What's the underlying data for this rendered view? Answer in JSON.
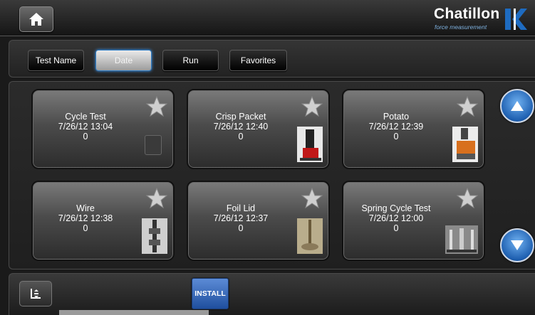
{
  "header": {
    "home_icon": "home-icon",
    "logo_name": "Chatillon",
    "logo_subtitle": "force measurement",
    "logo_trademark": "™"
  },
  "filters": [
    {
      "label": "Test Name",
      "active": false
    },
    {
      "label": "Date",
      "active": true
    },
    {
      "label": "Run",
      "active": false
    },
    {
      "label": "Favorites",
      "active": false
    }
  ],
  "tests": [
    {
      "name": "Cycle Test",
      "datetime": "7/26/12 13:04",
      "count": "0",
      "thumbnail": "empty"
    },
    {
      "name": "Crisp Packet",
      "datetime": "7/26/12 12:40",
      "count": "0",
      "thumbnail": "test-stand-red"
    },
    {
      "name": "Potato",
      "datetime": "7/26/12 12:39",
      "count": "0",
      "thumbnail": "fixture-orange"
    },
    {
      "name": "Wire",
      "datetime": "7/26/12 12:38",
      "count": "0",
      "thumbnail": "wire-grip"
    },
    {
      "name": "Foil Lid",
      "datetime": "7/26/12 12:37",
      "count": "0",
      "thumbnail": "foil-probe"
    },
    {
      "name": "Spring Cycle Test",
      "datetime": "7/26/12 12:00",
      "count": "0",
      "thumbnail": "spring-fixture"
    }
  ],
  "colors": {
    "accent_blue": "#2d7cc4",
    "install_blue": "#2a5cb0",
    "background": "#1a1a1a"
  },
  "footer": {
    "install_label": "INSTALL",
    "menu_icon": "sort-menu-icon"
  }
}
